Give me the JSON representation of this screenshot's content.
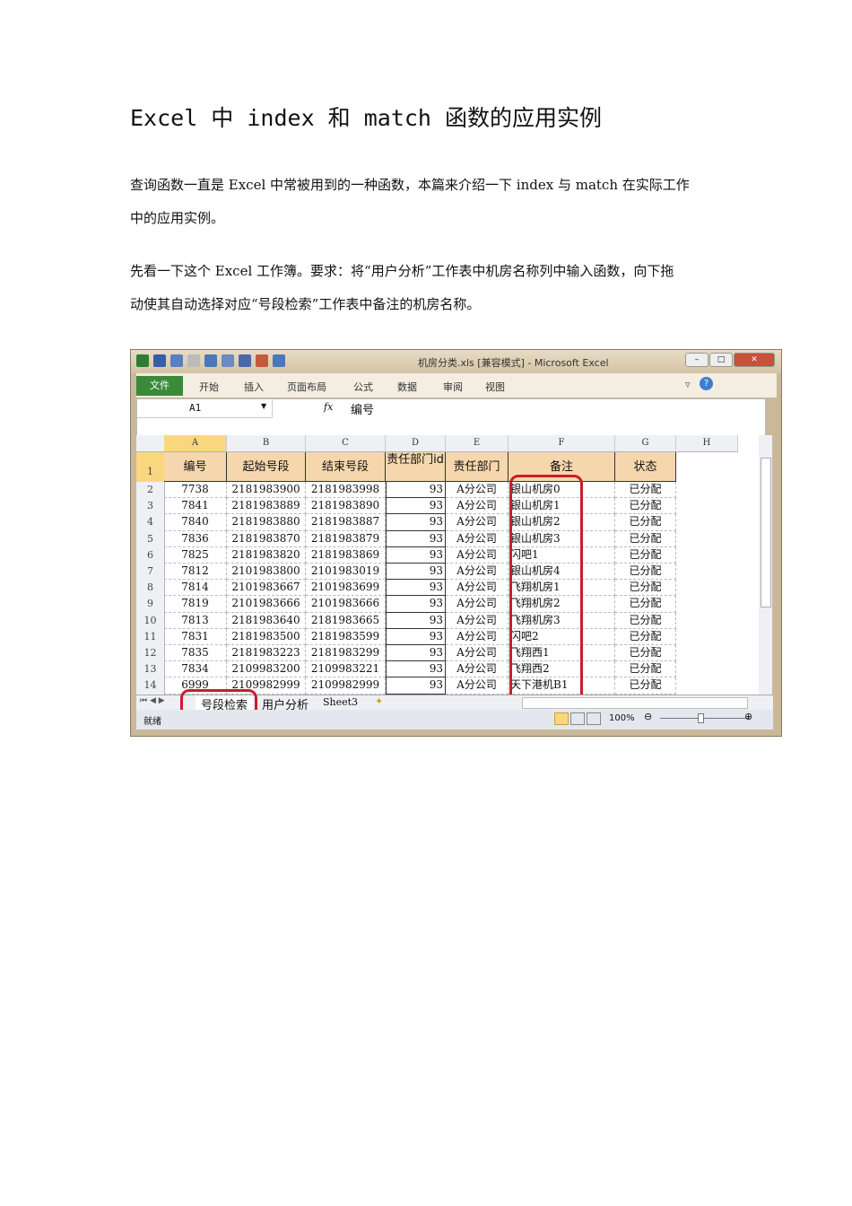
{
  "doc": {
    "title": "Excel 中 index 和 match 函数的应用实例",
    "para1_line1": "查询函数一直是 Excel 中常被用到的一种函数，本篇来介绍一下 index 与 match 在实际工作",
    "para1_line2": "中的应用实例。",
    "para2_line1": "先看一下这个 Excel 工作簿。要求：将“用户分析”工作表中机房名称列中输入函数，向下拖",
    "para2_line2": "动使其自动选择对应“号段检索”工作表中备注的机房名称。"
  },
  "excel": {
    "window_title": "机房分类.xls [兼容模式] - Microsoft Excel",
    "ribbon_tabs": [
      "文件",
      "开始",
      "插入",
      "页面布局",
      "公式",
      "数据",
      "审阅",
      "视图"
    ],
    "name_box": "A1",
    "fx": "fx",
    "formula": "编号",
    "columns": [
      "A",
      "B",
      "C",
      "D",
      "E",
      "F",
      "G",
      "H"
    ],
    "headers": [
      "编号",
      "起始号段",
      "结束号段",
      "责任部门id",
      "责任部门",
      "备注",
      "状态"
    ],
    "rows": [
      [
        "7738",
        "2181983900",
        "2181983998",
        "93",
        "A分公司",
        "银山机房0",
        "已分配"
      ],
      [
        "7841",
        "2181983889",
        "2181983890",
        "93",
        "A分公司",
        "银山机房1",
        "已分配"
      ],
      [
        "7840",
        "2181983880",
        "2181983887",
        "93",
        "A分公司",
        "银山机房2",
        "已分配"
      ],
      [
        "7836",
        "2181983870",
        "2181983879",
        "93",
        "A分公司",
        "银山机房3",
        "已分配"
      ],
      [
        "7825",
        "2181983820",
        "2181983869",
        "93",
        "A分公司",
        "闪吧1",
        "已分配"
      ],
      [
        "7812",
        "2101983800",
        "2101983019",
        "93",
        "A分公司",
        "银山机房4",
        "已分配"
      ],
      [
        "7814",
        "2101983667",
        "2101983699",
        "93",
        "A分公司",
        "飞翔机房1",
        "已分配"
      ],
      [
        "7819",
        "2101983666",
        "2101983666",
        "93",
        "A分公司",
        "飞翔机房2",
        "已分配"
      ],
      [
        "7813",
        "2181983640",
        "2181983665",
        "93",
        "A分公司",
        "飞翔机房3",
        "已分配"
      ],
      [
        "7831",
        "2181983500",
        "2181983599",
        "93",
        "A分公司",
        "闪吧2",
        "已分配"
      ],
      [
        "7835",
        "2181983223",
        "2181983299",
        "93",
        "A分公司",
        "飞翔西1",
        "已分配"
      ],
      [
        "7834",
        "2109983200",
        "2109983221",
        "93",
        "A分公司",
        "飞翔西2",
        "已分配"
      ],
      [
        "6999",
        "2109982999",
        "2109982999",
        "93",
        "A分公司",
        "天下港机B1",
        "已分配"
      ]
    ],
    "sheet_tabs": [
      "号段检索",
      "用户分析",
      "Sheet3"
    ],
    "status": "就绪",
    "zoom": "100%",
    "highlight_color": "#c81e2a",
    "file_tab_color": "#3b8a3a"
  }
}
